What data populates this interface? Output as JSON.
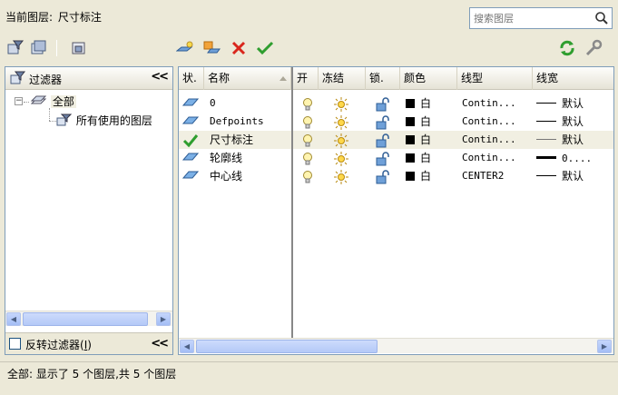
{
  "header": {
    "current_layer_label": "当前图层:",
    "current_layer_value": "尺寸标注",
    "search_placeholder": "搜索图层"
  },
  "filter_panel": {
    "title": "过滤器",
    "collapse_glyph": "<<",
    "tree": {
      "root_label": "全部",
      "child_label": "所有使用的图层"
    },
    "invert_filter_label": "反转过滤器",
    "invert_filter_hotkey": "I",
    "invert_filter_checked": false
  },
  "layer_grid": {
    "columns": [
      "状.",
      "名称",
      "开",
      "冻结",
      "锁.",
      "颜色",
      "线型",
      "线宽"
    ],
    "rows": [
      {
        "name": "0",
        "status_icon": "layer-icon",
        "on": true,
        "frozen": false,
        "locked": false,
        "color": "白",
        "linetype": "Contin...",
        "lineweight": "默认",
        "current": false
      },
      {
        "name": "Defpoints",
        "status_icon": "layer-icon",
        "on": true,
        "frozen": false,
        "locked": false,
        "color": "白",
        "linetype": "Contin...",
        "lineweight": "默认",
        "current": false
      },
      {
        "name": "尺寸标注",
        "status_icon": "current-check-icon",
        "on": true,
        "frozen": false,
        "locked": false,
        "color": "白",
        "linetype": "Contin...",
        "lineweight": "默认",
        "current": true
      },
      {
        "name": "轮廓线",
        "status_icon": "layer-icon",
        "on": true,
        "frozen": false,
        "locked": false,
        "color": "白",
        "linetype": "Contin...",
        "lineweight": "0....",
        "current": false
      },
      {
        "name": "中心线",
        "status_icon": "layer-icon",
        "on": true,
        "frozen": false,
        "locked": false,
        "color": "白",
        "linetype": "CENTER2",
        "lineweight": "默认",
        "current": false
      }
    ]
  },
  "status": {
    "text": "全部: 显示了 5 个图层,共 5 个图层"
  },
  "colors": {
    "window_bg": "#ece9d8",
    "panel_border": "#7f9db9",
    "accent_green": "#2f9e2f",
    "delete_red": "#d9261c",
    "scroll_blue": "#b4c9f7"
  }
}
